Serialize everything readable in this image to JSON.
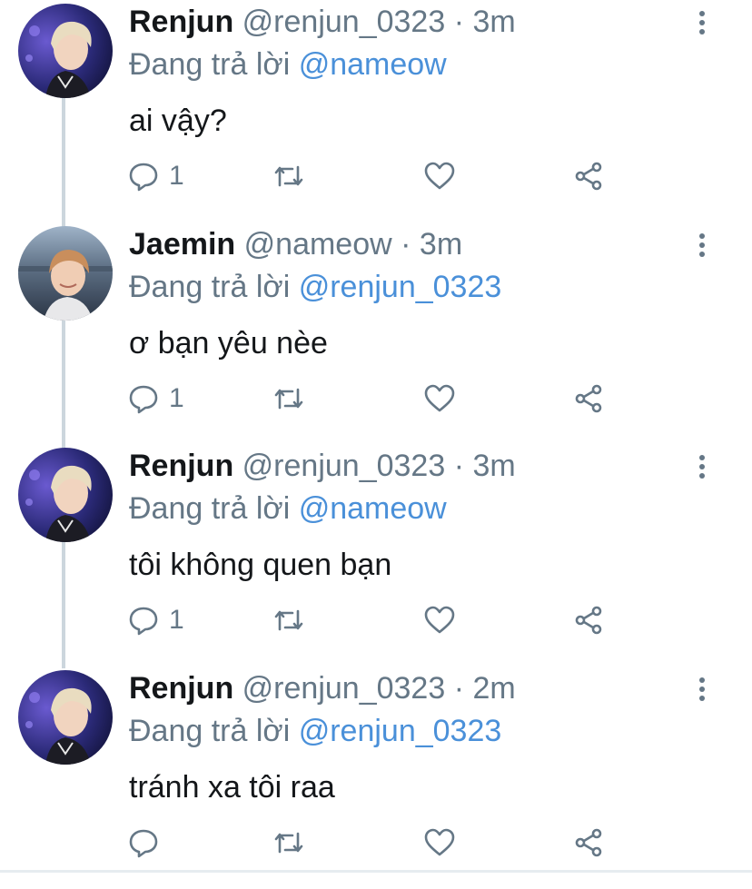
{
  "tweets": [
    {
      "name": "Renjun",
      "handle": "@renjun_0323",
      "dot": "·",
      "time": "3m",
      "reply_prefix": "Đang trả lời ",
      "reply_to": "@nameow",
      "text": "ai vậy?",
      "reply_count": "1",
      "avatar": "renjun"
    },
    {
      "name": "Jaemin",
      "handle": "@nameow",
      "dot": "·",
      "time": "3m",
      "reply_prefix": "Đang trả lời ",
      "reply_to": "@renjun_0323",
      "text": "ơ bạn yêu nèe",
      "reply_count": "1",
      "avatar": "jaemin"
    },
    {
      "name": "Renjun",
      "handle": "@renjun_0323",
      "dot": "·",
      "time": "3m",
      "reply_prefix": "Đang trả lời ",
      "reply_to": "@nameow",
      "text": "tôi không quen bạn",
      "reply_count": "1",
      "avatar": "renjun"
    },
    {
      "name": "Renjun",
      "handle": "@renjun_0323",
      "dot": "·",
      "time": "2m",
      "reply_prefix": "Đang trả lời ",
      "reply_to": "@renjun_0323",
      "text": "tránh xa tôi raa",
      "reply_count": "",
      "avatar": "renjun"
    }
  ],
  "colors": {
    "text": "#14171a",
    "secondary": "#657786",
    "mention": "#4a90d9",
    "thread_line": "#ccd6dd"
  },
  "icons": [
    "reply-icon",
    "retweet-icon",
    "like-icon",
    "share-icon",
    "more-icon"
  ]
}
